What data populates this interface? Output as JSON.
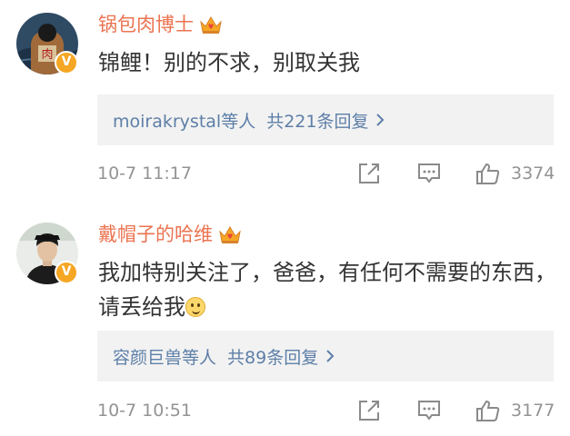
{
  "comments": [
    {
      "username": "锅包肉博士",
      "text": "锦鲤！别的不求，别取关我",
      "emoji": "",
      "replies": {
        "users": "moirakrystal等人",
        "count_label": "共221条回复"
      },
      "time": "10-7 11:17",
      "likes": "3374",
      "badge": "V",
      "icons": {
        "forward": "share-icon",
        "comment": "comment-icon",
        "like": "thumbs-up-icon"
      }
    },
    {
      "username": "戴帽子的哈维",
      "text": "我加特别关注了，爸爸，有任何不需要的东西，请丢给我",
      "emoji": "smile-emoji",
      "replies": {
        "users": "容颜巨兽等人",
        "count_label": "共89条回复"
      },
      "time": "10-7 10:51",
      "likes": "3177",
      "badge": "V",
      "icons": {
        "forward": "share-icon",
        "comment": "comment-icon",
        "like": "thumbs-up-icon"
      }
    }
  ],
  "colors": {
    "username": "#eb7350",
    "link": "#5d7fa8",
    "meta": "#939393",
    "reply_bg": "#f2f2f2",
    "badge": "#f5a623"
  }
}
